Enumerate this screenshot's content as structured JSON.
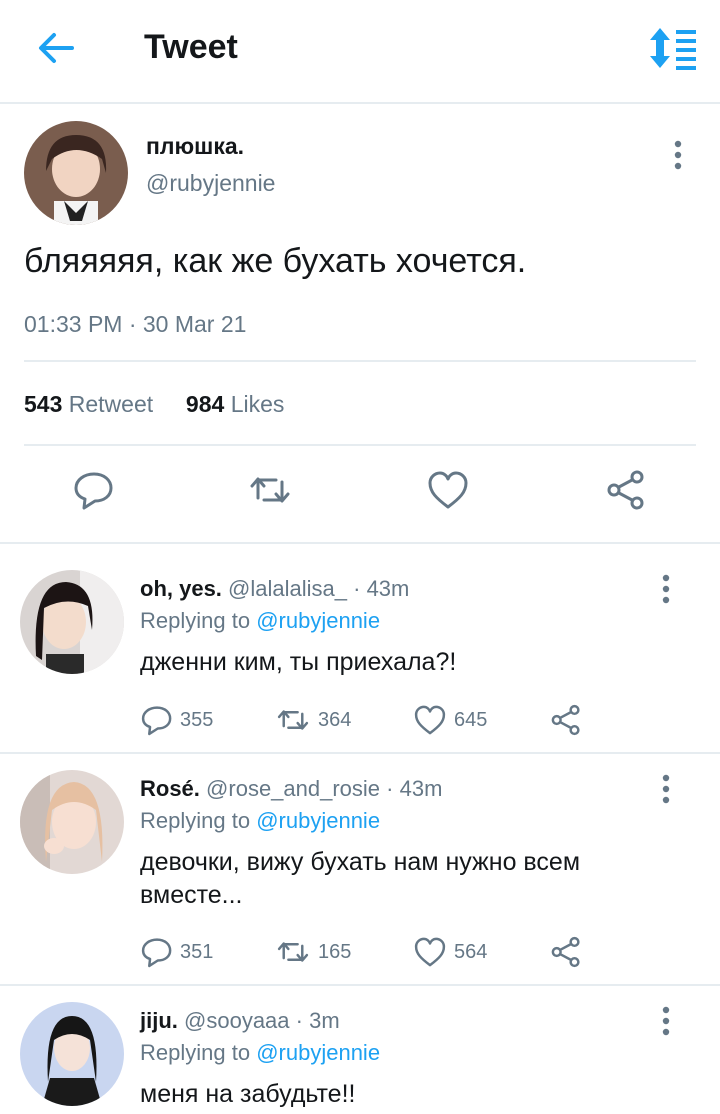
{
  "header": {
    "title": "Tweet",
    "back_icon": "arrow-left-icon",
    "sort_icon": "sort-lines-icon",
    "accent": "#1da1f2"
  },
  "tweet": {
    "name": "плюшка.",
    "handle": "@rubyjennie",
    "text": "бляяяяя, как же бухать хочется.",
    "timestamp": "01:33 PM · 30 Mar 21",
    "retweets": "543",
    "retweets_label": "Retweet",
    "likes": "984",
    "likes_label": "Likes"
  },
  "replies": [
    {
      "name": "oh, yes.",
      "handle": "@lalalalisa_",
      "time": "· 43m",
      "replying_prefix": "Replying to",
      "replying_to": "@rubyjennie",
      "text": "дженни ким, ты приехала?!",
      "replies": "355",
      "retweets": "364",
      "likes": "645"
    },
    {
      "name": "Rosé.",
      "handle": "@rose_and_rosie",
      "time": "· 43m",
      "replying_prefix": "Replying to",
      "replying_to": "@rubyjennie",
      "text": "девочки, вижу бухать нам нужно всем вместе...",
      "replies": "351",
      "retweets": "165",
      "likes": "564"
    },
    {
      "name": "jiju.",
      "handle": "@sooyaaa",
      "time": "· 3m",
      "replying_prefix": "Replying to",
      "replying_to": "@rubyjennie",
      "text": "меня на забудьте!!"
    }
  ]
}
